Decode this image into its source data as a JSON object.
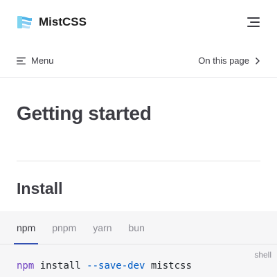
{
  "header": {
    "brand_name": "MistCSS",
    "logo_icon": "wind-icon",
    "menu_icon": "hamburger-icon"
  },
  "subnav": {
    "menu_label": "Menu",
    "on_this_page_label": "On this page"
  },
  "content": {
    "page_title": "Getting started",
    "section_title": "Install"
  },
  "code_group": {
    "tabs": [
      {
        "label": "npm",
        "active": true
      },
      {
        "label": "pnpm",
        "active": false
      },
      {
        "label": "yarn",
        "active": false
      },
      {
        "label": "bun",
        "active": false
      }
    ],
    "lang_label": "shell",
    "code": {
      "cmd": "npm",
      "sub": " install ",
      "flag": "--save-dev",
      "pkg": " mistcss"
    }
  },
  "colors": {
    "accent": "#3451b2",
    "text": "#3c3c43",
    "muted": "#8a8a92",
    "code_bg": "#f6f6f7"
  }
}
